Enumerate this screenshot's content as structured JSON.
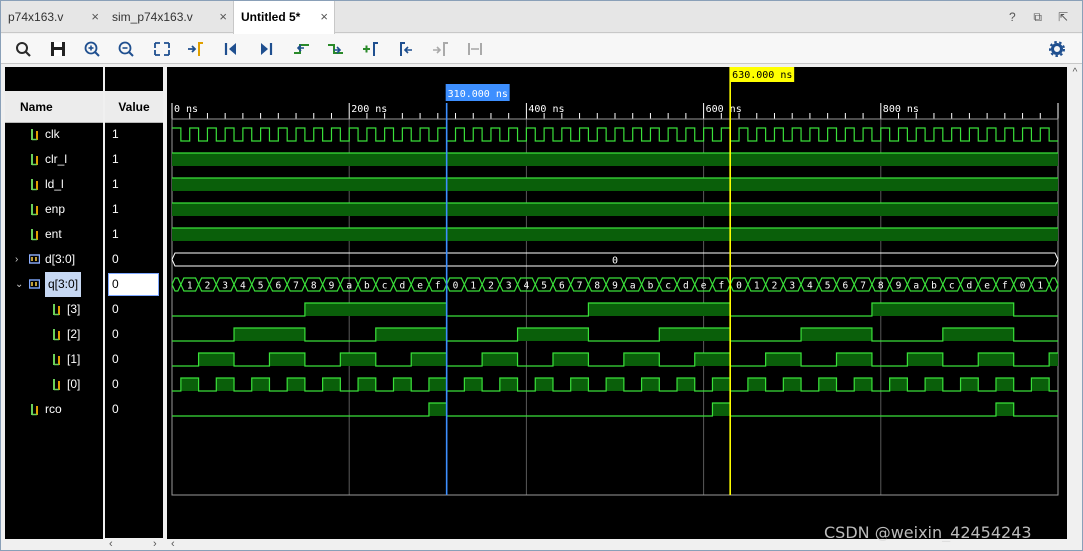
{
  "tabs": [
    {
      "label": "p74x163.v",
      "close": "×"
    },
    {
      "label": "sim_p74x163.v",
      "close": "×"
    },
    {
      "label": "Untitled 5*",
      "close": "×"
    }
  ],
  "tab_controls": {
    "help": "?",
    "restore": "⧉",
    "float": "⇱"
  },
  "toolbar": {
    "icons": [
      "search-icon",
      "save-icon",
      "zoom-in-icon",
      "zoom-out-icon",
      "zoom-fit-icon",
      "go-to-cursor-icon",
      "go-to-time-zero-icon",
      "go-to-last-time-icon",
      "previous-transition-icon",
      "next-transition-icon",
      "add-marker-icon",
      "previous-marker-icon",
      "next-marker-icon",
      "swap-cursors-icon",
      "settings-icon"
    ]
  },
  "columns": {
    "name": "Name",
    "value": "Value"
  },
  "signals": [
    {
      "name": "clk",
      "value": "1",
      "kind": "bit",
      "indent": 0
    },
    {
      "name": "clr_l",
      "value": "1",
      "kind": "bit",
      "indent": 0
    },
    {
      "name": "ld_l",
      "value": "1",
      "kind": "bit",
      "indent": 0
    },
    {
      "name": "enp",
      "value": "1",
      "kind": "bit",
      "indent": 0
    },
    {
      "name": "ent",
      "value": "1",
      "kind": "bit",
      "indent": 0
    },
    {
      "name": "d[3:0]",
      "value": "0",
      "kind": "bus",
      "indent": 0,
      "expander": "›"
    },
    {
      "name": "q[3:0]",
      "value": "0",
      "kind": "bus",
      "indent": 0,
      "expander": "⌄",
      "selected": true
    },
    {
      "name": "[3]",
      "value": "0",
      "kind": "bit",
      "indent": 1
    },
    {
      "name": "[2]",
      "value": "0",
      "kind": "bit",
      "indent": 1
    },
    {
      "name": "[1]",
      "value": "0",
      "kind": "bit",
      "indent": 1
    },
    {
      "name": "[0]",
      "value": "0",
      "kind": "bit",
      "indent": 1
    },
    {
      "name": "rco",
      "value": "0",
      "kind": "bit",
      "indent": 0
    }
  ],
  "timeline": {
    "range_ns": [
      0,
      1000
    ],
    "tick_labels": [
      {
        "t": 0,
        "label": "0 ns"
      },
      {
        "t": 200,
        "label": "200 ns"
      },
      {
        "t": 400,
        "label": "400 ns"
      },
      {
        "t": 600,
        "label": "600 ns"
      },
      {
        "t": 800,
        "label": "800 ns"
      }
    ],
    "clock_period_ns": 20,
    "count_start_ns": 10,
    "cursor_ns": 310,
    "cursor_label": "310.000 ns",
    "marker_ns": 630,
    "marker_label": "630.000 ns",
    "d_value": "0",
    "q_digits": [
      "0",
      "1",
      "2",
      "3",
      "4",
      "5",
      "6",
      "7",
      "8",
      "9",
      "a",
      "b",
      "c",
      "d",
      "e",
      "f"
    ]
  },
  "colors": {
    "wave": "#3ae03a",
    "wave_fill": "#0a5f0a",
    "cursor": "#3d8fff",
    "marker": "#ffff00",
    "background": "#000000"
  },
  "scroll": {
    "left": "‹",
    "right": "›",
    "up": "^",
    "down": "v"
  },
  "watermark": "CSDN @weixin_42454243"
}
